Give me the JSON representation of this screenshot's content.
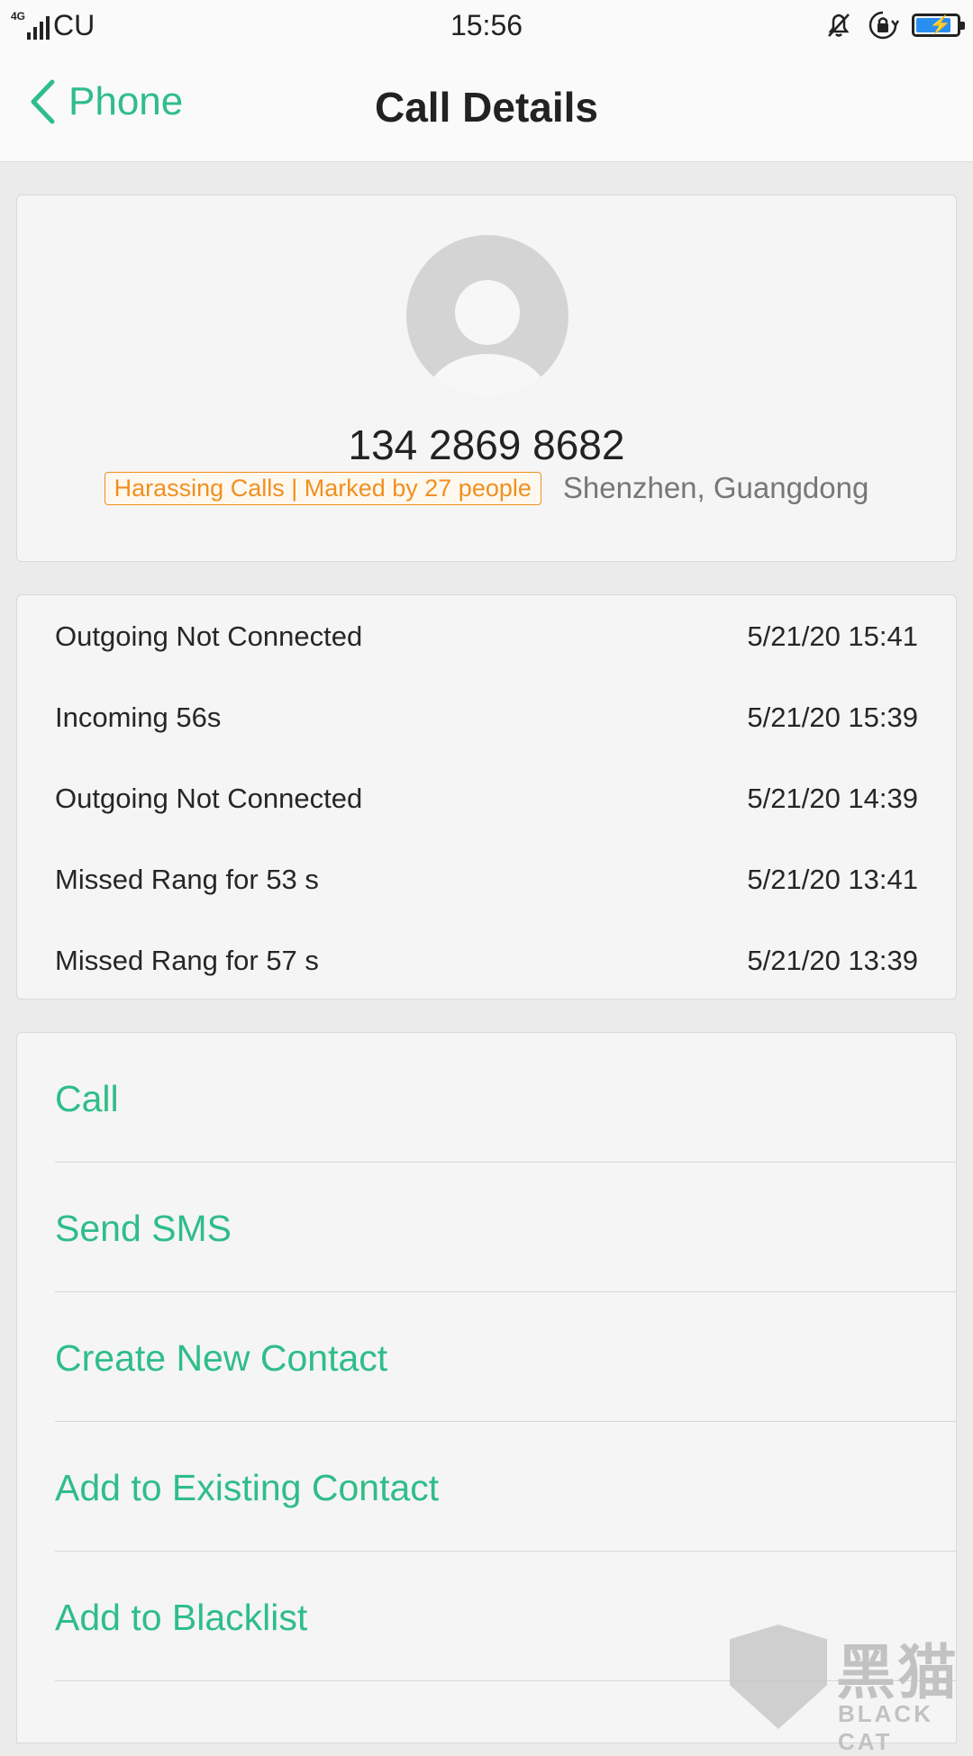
{
  "status_bar": {
    "network": "4G",
    "carrier": "CU",
    "time": "15:56",
    "icons": [
      "signal-icon",
      "bell-off-icon",
      "rotation-lock-icon",
      "battery-charging-icon"
    ],
    "battery_color": "#2a8ef0"
  },
  "header": {
    "back_label": "Phone",
    "title": "Call Details"
  },
  "contact": {
    "number": "134 2869 8682",
    "tag": "Harassing Calls | Marked by 27 people",
    "location": "Shenzhen, Guangdong"
  },
  "call_log": [
    {
      "type": "Outgoing Not Connected",
      "time": "5/21/20 15:41"
    },
    {
      "type": "Incoming  56s",
      "time": "5/21/20 15:39"
    },
    {
      "type": "Outgoing Not Connected",
      "time": "5/21/20 14:39"
    },
    {
      "type": "Missed  Rang for 53 s",
      "time": "5/21/20 13:41"
    },
    {
      "type": "Missed  Rang for 57 s",
      "time": "5/21/20 13:39"
    }
  ],
  "actions": [
    "Call",
    "Send SMS",
    "Create New Contact",
    "Add to Existing Contact",
    "Add to Blacklist"
  ],
  "watermark": {
    "cn": "黑猫",
    "en": "BLACK CAT"
  },
  "colors": {
    "accent": "#2fbd8a",
    "tag": "#f09020",
    "background": "#ebebeb",
    "card": "#f5f5f5"
  }
}
